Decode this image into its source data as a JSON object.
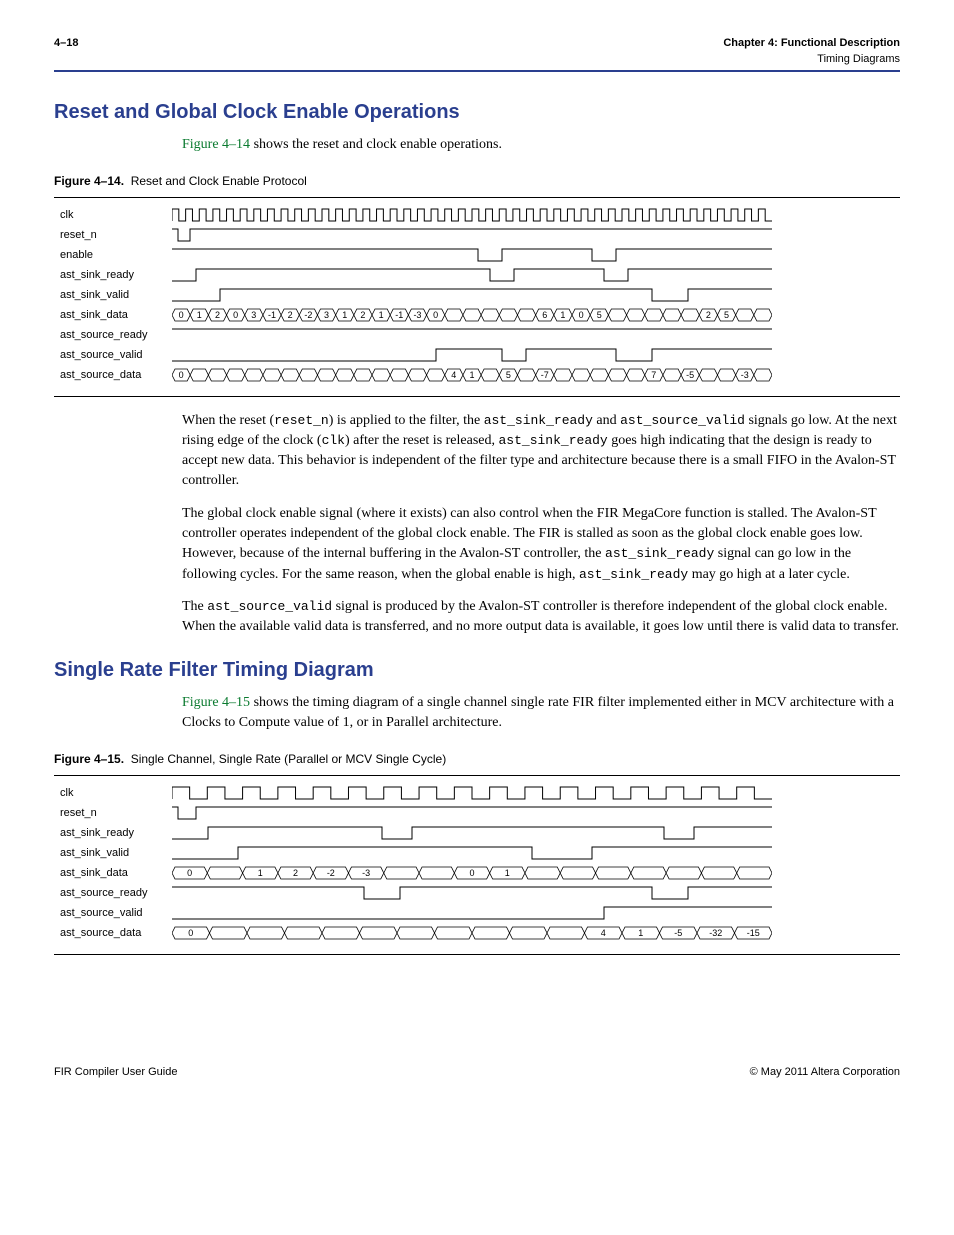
{
  "header": {
    "page_num": "4–18",
    "chapter": "Chapter 4:  Functional Description",
    "section": "Timing Diagrams"
  },
  "section1": {
    "title": "Reset and Global Clock Enable Operations",
    "intro_a": "Figure 4–14",
    "intro_b": " shows the reset and clock enable operations."
  },
  "fig14": {
    "label": "Figure 4–14.",
    "caption": "Reset and Clock Enable Protocol",
    "signals": [
      "clk",
      "reset_n",
      "enable",
      "ast_sink_ready",
      "ast_sink_valid",
      "ast_sink_data",
      "ast_source_ready",
      "ast_source_valid",
      "ast_source_data"
    ],
    "sink_data": [
      "0",
      "1",
      "2",
      "0",
      "3",
      "-1",
      "2",
      "-2",
      "3",
      "1",
      "2",
      "1",
      "-1",
      "-3",
      "0",
      "",
      "",
      "",
      "",
      "",
      "6",
      "1",
      "0",
      "5",
      "",
      "",
      "",
      "",
      "",
      "2",
      "5",
      "",
      ""
    ],
    "source_data": [
      "0",
      "",
      "",
      "",
      "",
      "",
      "",
      "",
      "",
      "",
      "",
      "",
      "",
      "",
      "",
      "4",
      "1",
      "",
      "5",
      "",
      "-7",
      "",
      "",
      "",
      "",
      "",
      "7",
      "",
      "-5",
      "",
      "",
      "-3",
      ""
    ]
  },
  "para1": {
    "t1": "When the reset (",
    "c1": "reset_n",
    "t2": ") is applied to the filter, the ",
    "c2": "ast_sink_ready",
    "t3": " and ",
    "c3": "ast_source_valid",
    "t4": " signals go low. At the next rising edge of the clock (",
    "c4": "clk",
    "t5": ") after the reset is released, ",
    "c5": "ast_sink_ready",
    "t6": " goes high indicating that the design is ready to accept new data. This behavior is independent of the filter type and architecture because there is a small FIFO in the Avalon-ST controller."
  },
  "para2": {
    "t1": "The global clock enable signal (where it exists) can also control when the FIR MegaCore function is stalled. The Avalon-ST controller operates independent of the global clock enable. The FIR is stalled as soon as the global clock enable goes low. However, because of the internal buffering in the Avalon-ST controller, the ",
    "c1": "ast_sink_ready",
    "t2": " signal can go low in the following cycles. For the same reason, when the global enable is high, ",
    "c2": "ast_sink_ready",
    "t3": " may go high at a later cycle."
  },
  "para3": {
    "t1": "The ",
    "c1": "ast_source_valid",
    "t2": " signal is produced by the Avalon-ST controller is therefore independent of the global clock enable. When the available valid data is transferred, and no more output data is available, it goes low until there is valid data to transfer."
  },
  "section2": {
    "title": "Single Rate Filter Timing Diagram",
    "intro_a": "Figure 4–15",
    "intro_b": " shows the timing diagram of a single channel single rate FIR filter implemented either in MCV architecture with a Clocks to Compute value of 1, or in Parallel architecture."
  },
  "fig15": {
    "label": "Figure 4–15.",
    "caption": "Single Channel, Single Rate (Parallel or MCV Single Cycle)",
    "signals": [
      "clk",
      "reset_n",
      "ast_sink_ready",
      "ast_sink_valid",
      "ast_sink_data",
      "ast_source_ready",
      "ast_source_valid",
      "ast_source_data"
    ],
    "sink_data": [
      "0",
      "",
      "1",
      "2",
      "-2",
      "-3",
      "",
      "",
      "0",
      "1",
      "",
      "",
      "",
      "",
      "",
      "",
      ""
    ],
    "source_data": [
      "0",
      "",
      "",
      "",
      "",
      "",
      "",
      "",
      "",
      "",
      "",
      "4",
      "1",
      "-5",
      "-32",
      "-15"
    ]
  },
  "footer": {
    "left": "FIR Compiler User Guide",
    "right": "© May 2011   Altera Corporation"
  }
}
